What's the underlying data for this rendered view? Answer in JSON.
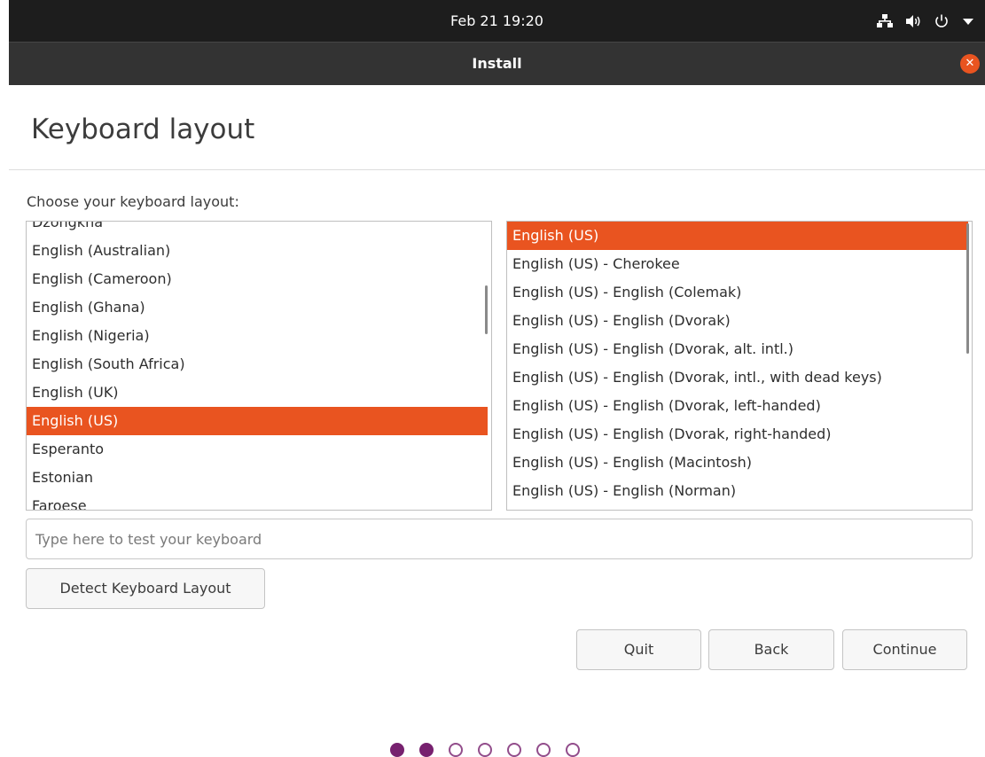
{
  "topbar": {
    "datetime": "Feb 21  19:20",
    "icons": [
      "network-icon",
      "volume-icon",
      "power-icon",
      "menu-arrow-icon"
    ]
  },
  "window": {
    "title": "Install",
    "close_icon": "close-icon"
  },
  "page": {
    "heading": "Keyboard layout",
    "prompt": "Choose your keyboard layout:"
  },
  "layouts": {
    "items": [
      "Dzongkha",
      "English (Australian)",
      "English (Cameroon)",
      "English (Ghana)",
      "English (Nigeria)",
      "English (South Africa)",
      "English (UK)",
      "English (US)",
      "Esperanto",
      "Estonian",
      "Faroese"
    ],
    "selected": "English (US)"
  },
  "variants": {
    "items": [
      "English (US)",
      "English (US) - Cherokee",
      "English (US) - English (Colemak)",
      "English (US) - English (Dvorak)",
      "English (US) - English (Dvorak, alt. intl.)",
      "English (US) - English (Dvorak, intl., with dead keys)",
      "English (US) - English (Dvorak, left-handed)",
      "English (US) - English (Dvorak, right-handed)",
      "English (US) - English (Macintosh)",
      "English (US) - English (Norman)"
    ],
    "selected": "English (US)"
  },
  "test": {
    "placeholder": "Type here to test your keyboard",
    "value": ""
  },
  "buttons": {
    "detect": "Detect Keyboard Layout",
    "quit": "Quit",
    "back": "Back",
    "continue": "Continue"
  },
  "progress": {
    "total_steps": 7,
    "completed_steps": 2
  },
  "colors": {
    "accent": "#e95420",
    "topbar": "#1d1d1d",
    "titlebar": "#333333",
    "progress_dot": "#77216f"
  }
}
